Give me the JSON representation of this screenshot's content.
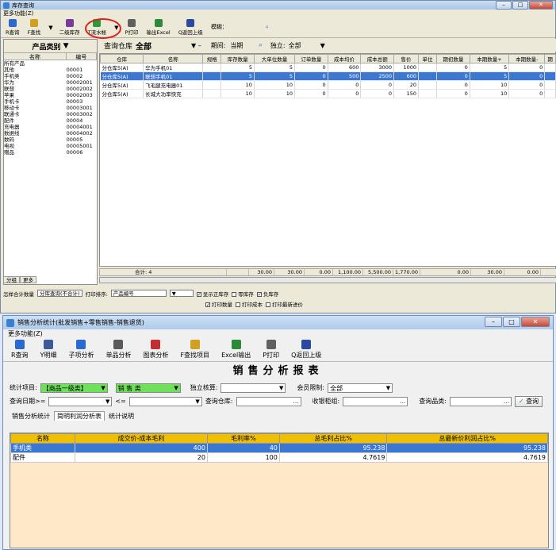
{
  "win1": {
    "title": "库存查询",
    "menu": "更多功能(Z)",
    "toolbar": [
      {
        "label": "R查询",
        "icon": "magnifier-icon",
        "color": "#2a6ad0"
      },
      {
        "label": "F查找",
        "icon": "find-icon",
        "color": "#d0a020"
      },
      {
        "label": "二级库存",
        "icon": "stock-icon",
        "color": "#7a3a9a"
      },
      {
        "label": "T流水帐",
        "icon": "ledger-icon",
        "color": "#2a9a3a"
      },
      {
        "label": "P打印",
        "icon": "printer-icon",
        "color": "#606060"
      },
      {
        "label": "输出Excel",
        "icon": "excel-icon",
        "color": "#2a8a3a"
      },
      {
        "label": "Q返回上级",
        "icon": "back-icon",
        "color": "#2a4aa0"
      }
    ],
    "fuzzy_label": "模糊：",
    "left": {
      "header": "产品类别",
      "col_name": "名称",
      "col_code": "编号",
      "tree": [
        {
          "name": "所有产品",
          "code": ""
        },
        {
          "name": "  其他",
          "code": "00001"
        },
        {
          "name": "  手机类",
          "code": "00002"
        },
        {
          "name": "    华为",
          "code": "00002001"
        },
        {
          "name": "    联想",
          "code": "00002002"
        },
        {
          "name": "    苹果",
          "code": "00002003"
        },
        {
          "name": "  手机卡",
          "code": "00003"
        },
        {
          "name": "    移动卡",
          "code": "00003001"
        },
        {
          "name": "    联通卡",
          "code": "00003002"
        },
        {
          "name": "  配件",
          "code": "00004"
        },
        {
          "name": "    充电器",
          "code": "00004001"
        },
        {
          "name": "    数据线",
          "code": "00004002"
        },
        {
          "name": "  数码",
          "code": "00005"
        },
        {
          "name": "    电视",
          "code": "00005001"
        },
        {
          "name": "  赠品",
          "code": "00006"
        }
      ],
      "tab1": "分组",
      "tab2": "更多"
    },
    "right": {
      "warehouse_label": "查询仓库",
      "warehouse_value": "全部",
      "period_label": "期间:",
      "period_value": "当期",
      "independent_label": "独立:",
      "independent_value": "全部",
      "columns": [
        "仓库",
        "名称",
        "规格",
        "库存数量",
        "大单位数量",
        "订单数量",
        "成本均价",
        "成本总额",
        "售价",
        "单位",
        "期初数量",
        "本期数量+",
        "本期数量-",
        "期"
      ],
      "rows": [
        [
          "分仓库5(A)",
          "华为手机01",
          "",
          "5",
          "5",
          "0",
          "600",
          "3000",
          "1000",
          "",
          "0",
          "5",
          "0"
        ],
        [
          "分仓库5(A)",
          "联想手机01",
          "",
          "5",
          "5",
          "0",
          "500",
          "2500",
          "600",
          "",
          "0",
          "5",
          "0"
        ],
        [
          "分仓库5(A)",
          "飞毛腿充电器01",
          "",
          "10",
          "10",
          "0",
          "0",
          "0",
          "20",
          "",
          "0",
          "10",
          "0"
        ],
        [
          "分仓库5(A)",
          "长城大功率快充",
          "",
          "10",
          "10",
          "0",
          "0",
          "0",
          "150",
          "",
          "0",
          "10",
          "0"
        ]
      ],
      "sum_label": "合计: 4",
      "sums": [
        "30.00",
        "30.00",
        "0.00",
        "1,100.00",
        "5,500.00",
        "1,770.00",
        "0.00",
        "30.00",
        "0.00"
      ]
    },
    "options": {
      "stat_label": "怎样合计数量",
      "stat_value": "分库查询(不合计)",
      "sort_label": "打印排序:",
      "sort_value": "产品编号",
      "checks": [
        {
          "label": "显示正库存",
          "on": true
        },
        {
          "label": "零库存",
          "on": false
        },
        {
          "label": "负库存",
          "on": true
        },
        {
          "label": "打印数量",
          "on": true
        },
        {
          "label": "打印成本",
          "on": false
        },
        {
          "label": "打印最新进价",
          "on": false
        }
      ]
    }
  },
  "win2": {
    "title": "销售分析统计(批发销售+零售销售-销售退货)",
    "menu": "更多功能(Z)",
    "toolbar": [
      {
        "label": "R查询",
        "icon": "magnifier-icon",
        "color": "#2a6ad0"
      },
      {
        "label": "Y明细",
        "icon": "detail-icon",
        "color": "#3a5a9a"
      },
      {
        "label": "子项分析",
        "icon": "subitem-icon",
        "color": "#2a6ad0"
      },
      {
        "label": "单品分析",
        "icon": "product-icon",
        "color": "#5a5a5a"
      },
      {
        "label": "图表分析",
        "icon": "chart-icon",
        "color": "#c03030"
      },
      {
        "label": "F查找项目",
        "icon": "find-icon",
        "color": "#d0a020"
      },
      {
        "label": "Excel输出",
        "icon": "excel-icon",
        "color": "#2a8a3a"
      },
      {
        "label": "P打印",
        "icon": "printer-icon",
        "color": "#606060"
      },
      {
        "label": "Q返回上级",
        "icon": "back-icon",
        "color": "#2a4aa0"
      }
    ],
    "report_title": "销售分析报表",
    "filters": {
      "stat_item_label": "统计项目:",
      "stat_item_value": "【商品一级类】",
      "stat_type_value": "销 售 类",
      "independent_label": "独立核算:",
      "member_label": "会员限制:",
      "member_value": "全部",
      "date_label": "查询日期>=",
      "date_to": "<=",
      "warehouse_label": "查询仓库:",
      "cashier_label": "收银柜组:",
      "product_label": "查询品类:",
      "query_btn": "查询"
    },
    "tabs": [
      "销售分析统计",
      "简明利润分析表",
      "统计说明"
    ],
    "columns": [
      "名称",
      "成交价-成本毛利",
      "毛利率%",
      "总毛利占比%",
      "总最新价利润占比%"
    ],
    "rows": [
      [
        "手机类",
        "400",
        "40",
        "95.238",
        "95.238"
      ],
      [
        "配件",
        "20",
        "100",
        "4.7619",
        "4.7619"
      ]
    ]
  }
}
